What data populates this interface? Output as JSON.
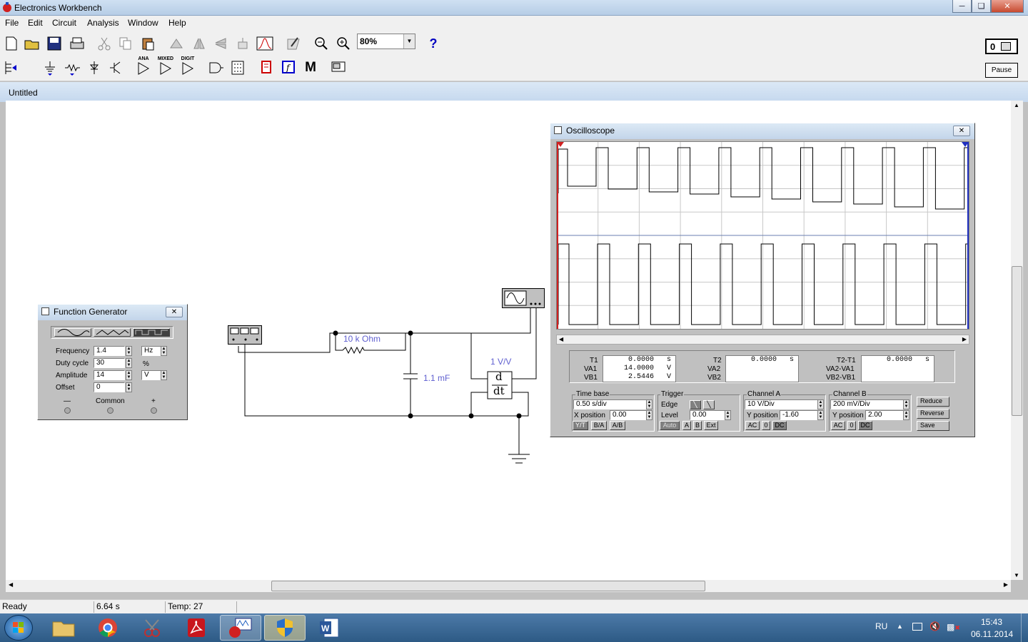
{
  "app": {
    "title": "Electronics Workbench"
  },
  "menu": [
    "File",
    "Edit",
    "Circuit",
    "Analysis",
    "Window",
    "Help"
  ],
  "toolbar": {
    "zoom": "80%",
    "help": "?",
    "pause_label": "Pause",
    "parts_labels": {
      "analog": "ANA",
      "mixed": "MIXED",
      "digital": "DIGIT",
      "misc": "M"
    }
  },
  "document": {
    "title": "Untitled"
  },
  "function_generator": {
    "title": "Function Generator",
    "frequency_label": "Frequency",
    "frequency_value": "1.4",
    "frequency_unit": "Hz",
    "duty_label": "Duty cycle",
    "duty_value": "30",
    "duty_unit": "%",
    "amplitude_label": "Amplitude",
    "amplitude_value": "14",
    "amplitude_unit": "V",
    "offset_label": "Offset",
    "offset_value": "0",
    "minus": "—",
    "common": "Common",
    "plus": "+"
  },
  "circuit": {
    "resistor_label": "10 k Ohm",
    "capacitor_label": "1.1 mF",
    "diff_gain": "1 V/V",
    "diff_top": "d",
    "diff_bottom": "dt"
  },
  "oscilloscope": {
    "title": "Oscilloscope",
    "t1_label": "T1",
    "va1_label": "VA1",
    "vb1_label": "VB1",
    "t1": "0.0000",
    "t1_unit": "s",
    "va1": "14.0000",
    "va1_unit": "V",
    "vb1": "2.5446",
    "vb1_unit": "V",
    "t2_label": "T2",
    "va2_label": "VA2",
    "vb2_label": "VB2",
    "t2": "0.0000",
    "t2_unit": "s",
    "dt_label": "T2-T1",
    "dva_label": "VA2-VA1",
    "dvb_label": "VB2-VB1",
    "dt": "0.0000",
    "dt_unit": "s",
    "timebase_title": "Time base",
    "timebase": "0.50 s/div",
    "xpos_label": "X position",
    "xpos": "0.00",
    "yt": "Y/T",
    "ba": "B/A",
    "ab": "A/B",
    "trigger_title": "Trigger",
    "edge_label": "Edge",
    "level_label": "Level",
    "level": "0.00",
    "auto": "Auto",
    "a": "A",
    "b": "B",
    "ext": "Ext",
    "cha_title": "Channel A",
    "cha_scale": "10  V/Div",
    "ypos_label": "Y position",
    "cha_ypos": "-1.60",
    "ac": "AC",
    "zero": "0",
    "dc": "DC",
    "chb_title": "Channel B",
    "chb_scale": "200 mV/Div",
    "chb_ypos": "2.00",
    "reduce": "Reduce",
    "reverse": "Reverse",
    "save": "Save",
    "cursor1": "1",
    "cursor2": "2"
  },
  "status": {
    "ready": "Ready",
    "time": "6.64 s",
    "temp": "Temp:  27"
  },
  "taskbar": {
    "lang": "RU",
    "time": "15:43",
    "date": "06.11.2014"
  }
}
